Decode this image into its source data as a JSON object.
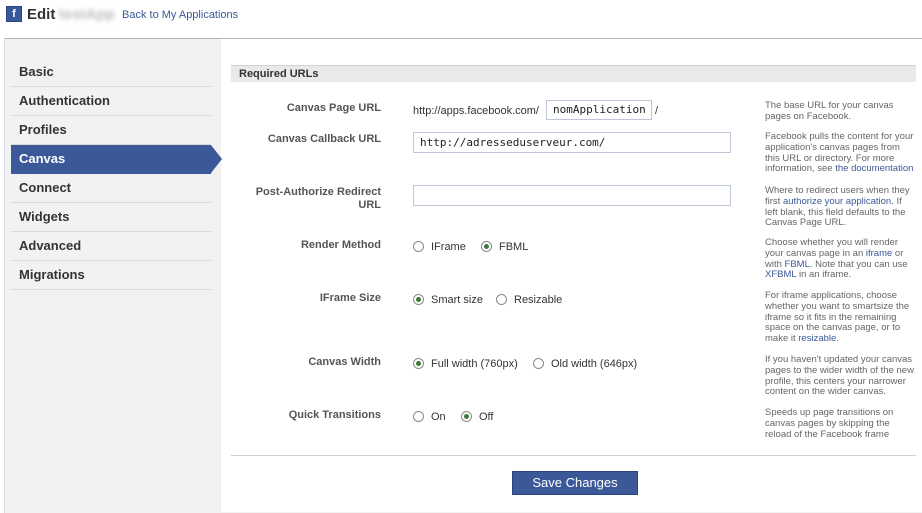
{
  "header": {
    "icon_letter": "f",
    "edit_label": "Edit",
    "app_name": "testApp",
    "back_link": "Back to My Applications"
  },
  "sidebar": {
    "items": [
      {
        "label": "Basic"
      },
      {
        "label": "Authentication"
      },
      {
        "label": "Profiles"
      },
      {
        "label": "Canvas",
        "active": true
      },
      {
        "label": "Connect"
      },
      {
        "label": "Widgets"
      },
      {
        "label": "Advanced"
      },
      {
        "label": "Migrations"
      }
    ]
  },
  "section": {
    "title": "Required URLs"
  },
  "canvas_page_url": {
    "label": "Canvas Page URL",
    "prefix": "http://apps.facebook.com/",
    "value": "nomApplication",
    "suffix": "/",
    "help": "The base URL for your canvas pages on Facebook."
  },
  "canvas_callback_url": {
    "label": "Canvas Callback URL",
    "value": "http://adresseduserveur.com/",
    "help_pre": "Facebook pulls the content for your application's canvas pages from this URL or directory. For more information, see ",
    "help_link": "the documentation"
  },
  "post_authorize": {
    "label": "Post-Authorize Redirect URL",
    "value": "",
    "help_pre": "Where to redirect users when they first ",
    "help_link": "authorize your application",
    "help_post": ". If left blank, this field defaults to the Canvas Page URL."
  },
  "render_method": {
    "label": "Render Method",
    "options": [
      "IFrame",
      "FBML"
    ],
    "selected": "FBML",
    "help_1": "Choose whether you will render your canvas page in an ",
    "help_link1": "iframe",
    "help_2": " or with ",
    "help_link2": "FBML",
    "help_3": ". Note that you can use ",
    "help_link3": "XFBML",
    "help_4": " in an iframe."
  },
  "iframe_size": {
    "label": "IFrame Size",
    "options": [
      "Smart size",
      "Resizable"
    ],
    "selected": "Smart size",
    "help_pre": "For iframe applications, choose whether you want to smartsize the iframe so it fits in the remaining space on the canvas page, or to make it ",
    "help_link": "resizable",
    "help_post": "."
  },
  "canvas_width": {
    "label": "Canvas Width",
    "options": [
      "Full width (760px)",
      "Old width (646px)"
    ],
    "selected": "Full width (760px)",
    "help": "If you haven't updated your canvas pages to the wider width of the new profile, this centers your narrower content on the wider canvas."
  },
  "quick_transitions": {
    "label": "Quick Transitions",
    "options": [
      "On",
      "Off"
    ],
    "selected": "Off",
    "help": "Speeds up page transitions on canvas pages by skipping the reload of the Facebook frame"
  },
  "footer": {
    "save_label": "Save Changes"
  },
  "colors": {
    "brand": "#3b5998",
    "link": "#3b5998",
    "sidebar_bg": "#f2f2f2"
  }
}
